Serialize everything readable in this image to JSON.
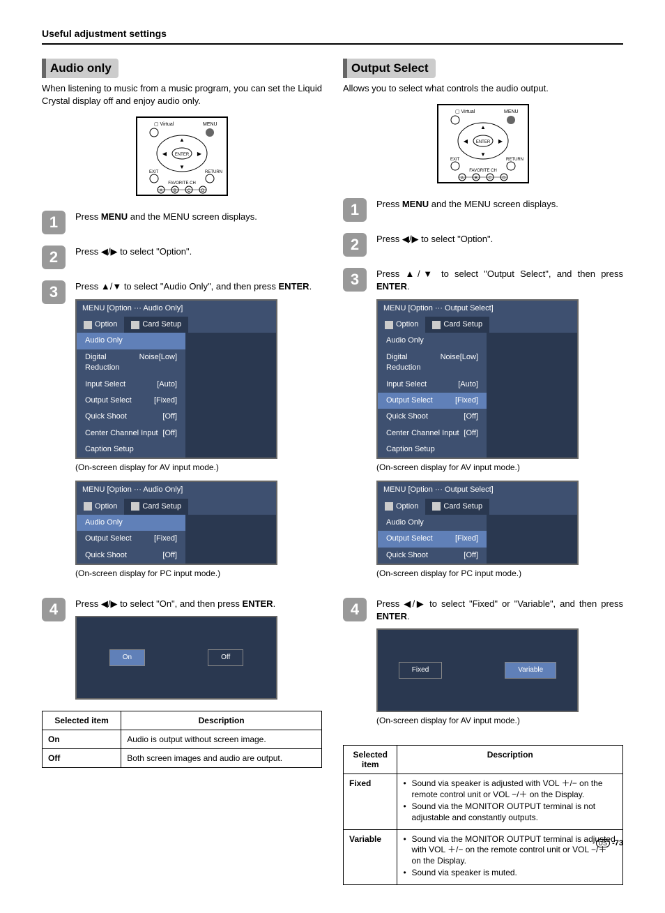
{
  "pageTitle": "Useful adjustment settings",
  "pageNumber": "-73",
  "pageNumberPrefix": "US",
  "left": {
    "heading": "Audio only",
    "intro": "When listening to music from a music program, you can set the Liquid Crystal display off and enjoy audio only.",
    "steps": {
      "s1": {
        "a": "Press ",
        "b": "MENU",
        "c": " and the MENU screen displays."
      },
      "s2": {
        "a": "Press ",
        "arrows": "◀/▶",
        "c": " to select \"Option\"."
      },
      "s3": {
        "a": "Press ",
        "arrows": "▲/▼",
        "c": " to select \"Audio Only\", and then press ",
        "d": "ENTER",
        "e": "."
      },
      "s4": {
        "a": "Press ",
        "arrows": "◀/▶",
        "c": " to select \"On\", and then press ",
        "d": "ENTER",
        "e": "."
      }
    },
    "menuA": {
      "header": "MENU    [Option ··· Audio Only]",
      "tabs": [
        "Option",
        "Card Setup"
      ],
      "items": [
        {
          "label": "Audio Only",
          "value": ""
        },
        {
          "label": "Digital Noise Reduction",
          "value": "[Low]"
        },
        {
          "label": "Input Select",
          "value": "[Auto]"
        },
        {
          "label": "Output Select",
          "value": "[Fixed]"
        },
        {
          "label": "Quick Shoot",
          "value": "[Off]"
        },
        {
          "label": "Center Channel Input",
          "value": "[Off]"
        },
        {
          "label": "Caption Setup",
          "value": ""
        }
      ]
    },
    "captionA": "(On-screen display for AV input mode.)",
    "menuB": {
      "header": "MENU    [Option ··· Audio Only]",
      "tabs": [
        "Option",
        "Card Setup"
      ],
      "items": [
        {
          "label": "Audio Only",
          "value": ""
        },
        {
          "label": "Output Select",
          "value": "[Fixed]"
        },
        {
          "label": "Quick Shoot",
          "value": "[Off]"
        }
      ]
    },
    "captionB": "(On-screen display for PC input mode.)",
    "selectA": {
      "on": "On",
      "off": "Off"
    },
    "table": {
      "h1": "Selected item",
      "h2": "Description",
      "rows": [
        {
          "k": "On",
          "v": "Audio is output without screen image."
        },
        {
          "k": "Off",
          "v": "Both screen images and audio are output."
        }
      ]
    }
  },
  "right": {
    "heading": "Output Select",
    "intro": "Allows you to select what controls the audio output.",
    "steps": {
      "s1": {
        "a": "Press ",
        "b": "MENU",
        "c": " and the MENU screen displays."
      },
      "s2": {
        "a": "Press ",
        "arrows": "◀/▶",
        "c": " to select \"Option\"."
      },
      "s3": {
        "a": "Press ",
        "arrows": "▲/▼",
        "c": " to select \"Output Select\", and then press ",
        "d": "ENTER",
        "e": "."
      },
      "s4": {
        "a": "Press ",
        "arrows": "◀/▶",
        "c": " to select \"Fixed\" or \"Variable\", and then press ",
        "d": "ENTER",
        "e": "."
      }
    },
    "menuA": {
      "header": "MENU    [Option ··· Output Select]",
      "tabs": [
        "Option",
        "Card Setup"
      ],
      "items": [
        {
          "label": "Audio Only",
          "value": ""
        },
        {
          "label": "Digital Noise Reduction",
          "value": "[Low]"
        },
        {
          "label": "Input Select",
          "value": "[Auto]"
        },
        {
          "label": "Output Select",
          "value": "[Fixed]"
        },
        {
          "label": "Quick Shoot",
          "value": "[Off]"
        },
        {
          "label": "Center Channel Input",
          "value": "[Off]"
        },
        {
          "label": "Caption Setup",
          "value": ""
        }
      ]
    },
    "captionA": "(On-screen display for AV input mode.)",
    "menuB": {
      "header": "MENU    [Option ··· Output Select]",
      "tabs": [
        "Option",
        "Card Setup"
      ],
      "items": [
        {
          "label": "Audio Only",
          "value": ""
        },
        {
          "label": "Output Select",
          "value": "[Fixed]"
        },
        {
          "label": "Quick Shoot",
          "value": "[Off]"
        }
      ]
    },
    "captionB": "(On-screen display for PC input mode.)",
    "selectA": {
      "fixed": "Fixed",
      "variable": "Variable"
    },
    "captionC": "(On-screen display for AV input mode.)",
    "table": {
      "h1": "Selected item",
      "h2": "Description",
      "rows": [
        {
          "k": "Fixed",
          "v": [
            "Sound via speaker is adjusted with VOL ＋/− on the remote control unit or VOL −/＋ on the Display.",
            "Sound via the MONITOR OUTPUT terminal is not adjustable and constantly outputs."
          ]
        },
        {
          "k": "Variable",
          "v": [
            "Sound via the MONITOR OUTPUT terminal is adjusted with VOL ＋/− on the remote control unit or VOL −/＋ on the Display.",
            "Sound via speaker is muted."
          ]
        }
      ]
    }
  }
}
